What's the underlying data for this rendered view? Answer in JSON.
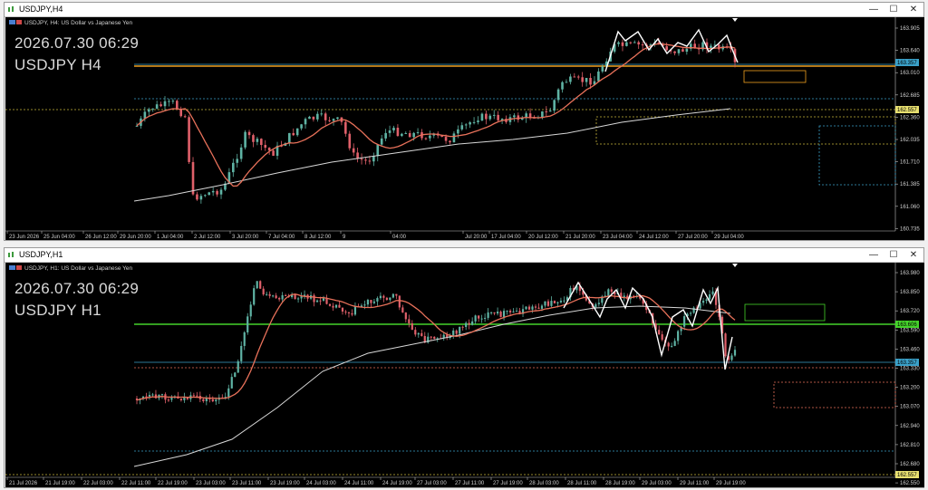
{
  "colors": {
    "background": "#000000",
    "bull": "#5fb3a4",
    "bear": "#e0606a",
    "ma_fast": "#e8715a",
    "ma_slow": "#d8d8d8",
    "zigzag": "#ffffff",
    "orange_line": "#f0a020",
    "green_line": "#44d22a",
    "yellow_dot": "#c8b43c",
    "blue_dot": "#3aa0c8",
    "white_dot": "#8aa0b0"
  },
  "windows": [
    {
      "title": "USDJPY,H4",
      "info": "USDJPY, H4:  US Dollar vs Japanese Yen",
      "big_date": "2026.07.30 06:29",
      "big_symbol": "USDJPY H4",
      "price_ticks": [
        "163.905",
        "163.640",
        "163.010",
        "162.685",
        "162.360",
        "162.035",
        "161.710",
        "161.385",
        "161.060",
        "160.735"
      ],
      "price_labels": [
        {
          "text": "163.357",
          "kind": "blue"
        },
        {
          "text": "162.557",
          "kind": "yellow"
        }
      ],
      "time_ticks": [
        "23 Jun 2026",
        "25 Jun 04:00",
        "26 Jun 12:00",
        "29 Jun 20:00",
        "1 Jul 04:00",
        "2 Jul 12:00",
        "3 Jul 20:00",
        "7 Jul 04:00",
        "8 Jul 12:00",
        "9",
        "04:00",
        "Jul 20:00",
        "17 Jul 04:00",
        "20 Jul 12:00",
        "21 Jul 20:00",
        "23 Jul 04:00",
        "24 Jul 12:00",
        "27 Jul 20:00",
        "29 Jul 04:00"
      ]
    },
    {
      "title": "USDJPY,H1",
      "info": "USDJPY, H1:  US Dollar vs Japanese Yen",
      "big_date": "2026.07.30 06:29",
      "big_symbol": "USDJPY H1",
      "price_ticks": [
        "163.980",
        "163.850",
        "163.720",
        "163.590",
        "163.460",
        "163.330",
        "163.200",
        "163.070",
        "162.940",
        "162.810",
        "162.680",
        "162.550"
      ],
      "price_labels": [
        {
          "text": "163.606",
          "kind": "green"
        },
        {
          "text": "163.357",
          "kind": "blue"
        },
        {
          "text": "162.557",
          "kind": "yellow"
        }
      ],
      "time_ticks": [
        "21 Jul 2026",
        "21 Jul 19:00",
        "22 Jul 03:00",
        "22 Jul 11:00",
        "22 Jul 19:00",
        "23 Jul 03:00",
        "23 Jul 11:00",
        "23 Jul 19:00",
        "24 Jul 03:00",
        "24 Jul 11:00",
        "24 Jul 19:00",
        "27 Jul 03:00",
        "27 Jul 11:00",
        "27 Jul 19:00",
        "28 Jul 03:00",
        "28 Jul 11:00",
        "28 Jul 19:00",
        "29 Jul 03:00",
        "29 Jul 11:00",
        "29 Jul 19:00"
      ]
    }
  ],
  "window_buttons": {
    "minimize": "—",
    "maximize": "☐",
    "close": "✕"
  }
}
